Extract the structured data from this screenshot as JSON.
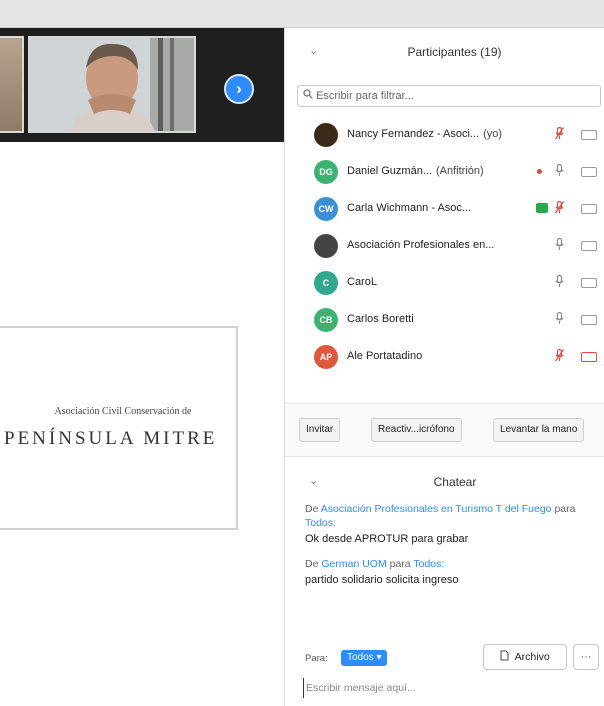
{
  "meeting": {
    "next_page_glyph": "›",
    "shared_content": {
      "org_subtitle": "Asociación Civil Conservación de",
      "org_name": "PENÍNSULA MITRE"
    }
  },
  "participants_panel": {
    "collapse_glyph": "⌄",
    "title": "Participantes (19)",
    "search_placeholder": "Escribir para filtrar...",
    "participants": [
      {
        "initials": "",
        "name": "Nancy Fernandez - Asoci...",
        "role": "(yo)",
        "avatar_color": "#3a2a1a",
        "mic": "muted",
        "video": "off",
        "extra": ""
      },
      {
        "initials": "DG",
        "name": "Daniel Guzmán...",
        "role": "(Anfitrión)",
        "avatar_color": "#3cb371",
        "mic": "on",
        "video": "off",
        "extra": "rec"
      },
      {
        "initials": "CW",
        "name": "Carla Wichmann - Asoc...",
        "role": "",
        "avatar_color": "#3a8fd6",
        "mic": "muted",
        "video": "off",
        "extra": "screen"
      },
      {
        "initials": "",
        "name": "Asociación Profesionales en...",
        "role": "",
        "avatar_color": "#444444",
        "mic": "on",
        "video": "off",
        "extra": ""
      },
      {
        "initials": "C",
        "name": "CaroL",
        "role": "",
        "avatar_color": "#2fa88e",
        "mic": "on",
        "video": "off",
        "extra": ""
      },
      {
        "initials": "CB",
        "name": "Carlos Boretti",
        "role": "",
        "avatar_color": "#3cb371",
        "mic": "on",
        "video": "off",
        "extra": ""
      },
      {
        "initials": "AP",
        "name": "Ale Portatadino",
        "role": "",
        "avatar_color": "#e0583c",
        "mic": "muted",
        "video": "off-red",
        "extra": ""
      }
    ],
    "buttons": {
      "invite": "Invitar",
      "reactivate_mic": "Reactiv...icrófono",
      "raise_hand": "Levantar la mano"
    }
  },
  "chat": {
    "collapse_glyph": "⌄",
    "title": "Chatear",
    "messages": [
      {
        "prefix": "De",
        "sender": "Asociación Profesionales en Turismo T del Fuego",
        "mid": "para",
        "recipient": "Todos:",
        "text": "Ok desde APROTUR para grabar"
      },
      {
        "prefix": "De",
        "sender": "German UOM",
        "mid": "para",
        "recipient": "Todos:",
        "text": "partido solidario solicita ingreso"
      }
    ],
    "to_label": "Para:",
    "to_value": "Todos ▾",
    "file_label": "Archivo",
    "more_glyph": "···",
    "input_placeholder": "Escribir mensaje aquí..."
  },
  "colors": {
    "accent": "#2d8cff",
    "muted_red": "#e0483c",
    "dark_bar": "#1f1f1f"
  }
}
